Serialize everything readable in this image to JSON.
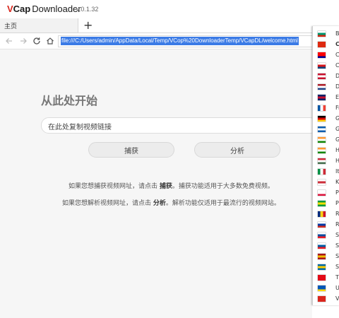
{
  "app": {
    "logo_v": "V",
    "logo_cap": "Cap",
    "logo_name": "Downloader",
    "version": "v.0.1.32"
  },
  "tabs": [
    {
      "label": "主页"
    }
  ],
  "new_tab": "+",
  "address": {
    "url": "file:///C:/Users/admin/AppData/Local/Temp/VCop%20DownloaderTemp/VCapDL/welcome.html"
  },
  "main": {
    "heading": "从此处开始",
    "input_value": "在此处复制视频链接",
    "capture_label": "捕获",
    "analyze_label": "分析",
    "hint1_a": "如果您想捕获视频网址，请点击 ",
    "hint1_b": "捕获",
    "hint1_c": "。捕获功能适用于大多数免费视频。",
    "hint2_a": "如果您想解析视频网址，请点击 ",
    "hint2_b": "分析",
    "hint2_c": "。解析功能仅适用于最流行的视频网站。"
  },
  "languages": [
    {
      "code": "Bu",
      "flag": [
        "#ffffff",
        "#00966e",
        "#d62612"
      ],
      "dir": "h",
      "selected": false
    },
    {
      "code": "C",
      "flag": [
        "#de2910",
        "#de2910",
        "#de2910"
      ],
      "dir": "h",
      "selected": true
    },
    {
      "code": "Cl",
      "flag": [
        "#fe0000",
        "#fe0000",
        "#000095"
      ],
      "dir": "h",
      "selected": false
    },
    {
      "code": "Cz",
      "flag": [
        "#ffffff",
        "#d7141a",
        "#11457e"
      ],
      "dir": "h",
      "selected": false
    },
    {
      "code": "Da",
      "flag": [
        "#c8102e",
        "#ffffff",
        "#c8102e"
      ],
      "dir": "h",
      "selected": false
    },
    {
      "code": "Du",
      "flag": [
        "#ae1c28",
        "#ffffff",
        "#21468b"
      ],
      "dir": "h",
      "selected": false
    },
    {
      "code": "En",
      "flag": [
        "#012169",
        "#c8102e",
        "#012169"
      ],
      "dir": "h",
      "selected": false
    },
    {
      "code": "Fr",
      "flag": [
        "#0055a4",
        "#ffffff",
        "#ef4135"
      ],
      "dir": "v",
      "selected": false
    },
    {
      "code": "Ge",
      "flag": [
        "#000000",
        "#dd0000",
        "#ffce00"
      ],
      "dir": "h",
      "selected": false
    },
    {
      "code": "Gr",
      "flag": [
        "#0d5eaf",
        "#ffffff",
        "#0d5eaf"
      ],
      "dir": "h",
      "selected": false
    },
    {
      "code": "Gu",
      "flag": [
        "#ff9933",
        "#ffffff",
        "#138808"
      ],
      "dir": "h",
      "selected": false
    },
    {
      "code": "Hi",
      "flag": [
        "#ff9933",
        "#ffffff",
        "#138808"
      ],
      "dir": "h",
      "selected": false
    },
    {
      "code": "Hu",
      "flag": [
        "#ce2939",
        "#ffffff",
        "#477050"
      ],
      "dir": "h",
      "selected": false
    },
    {
      "code": "It",
      "flag": [
        "#009246",
        "#ffffff",
        "#ce2b37"
      ],
      "dir": "v",
      "selected": false
    },
    {
      "code": "Ko",
      "flag": [
        "#ffffff",
        "#cd2e3a",
        "#ffffff"
      ],
      "dir": "h",
      "selected": false
    },
    {
      "code": "Po",
      "flag": [
        "#ffffff",
        "#ffffff",
        "#dc143c"
      ],
      "dir": "h",
      "selected": false
    },
    {
      "code": "Pt",
      "flag": [
        "#009c3b",
        "#ffdf00",
        "#009c3b"
      ],
      "dir": "h",
      "selected": false
    },
    {
      "code": "Ro",
      "flag": [
        "#002b7f",
        "#fcd116",
        "#ce1126"
      ],
      "dir": "v",
      "selected": false
    },
    {
      "code": "Ru",
      "flag": [
        "#ffffff",
        "#0039a6",
        "#d52b1e"
      ],
      "dir": "h",
      "selected": false
    },
    {
      "code": "Sl",
      "flag": [
        "#ffffff",
        "#0b4ea2",
        "#ee1c25"
      ],
      "dir": "h",
      "selected": false
    },
    {
      "code": "Sl",
      "flag": [
        "#ffffff",
        "#005da4",
        "#ed1c24"
      ],
      "dir": "h",
      "selected": false
    },
    {
      "code": "Sp",
      "flag": [
        "#aa151b",
        "#f1bf00",
        "#aa151b"
      ],
      "dir": "h",
      "selected": false
    },
    {
      "code": "Sv",
      "flag": [
        "#006aa7",
        "#fecc00",
        "#006aa7"
      ],
      "dir": "h",
      "selected": false
    },
    {
      "code": "T",
      "flag": [
        "#e30a17",
        "#e30a17",
        "#e30a17"
      ],
      "dir": "h",
      "selected": false
    },
    {
      "code": "U",
      "flag": [
        "#0057b7",
        "#0057b7",
        "#ffd700"
      ],
      "dir": "h",
      "selected": false
    },
    {
      "code": "V",
      "flag": [
        "#da251d",
        "#da251d",
        "#da251d"
      ],
      "dir": "h",
      "selected": false
    }
  ]
}
